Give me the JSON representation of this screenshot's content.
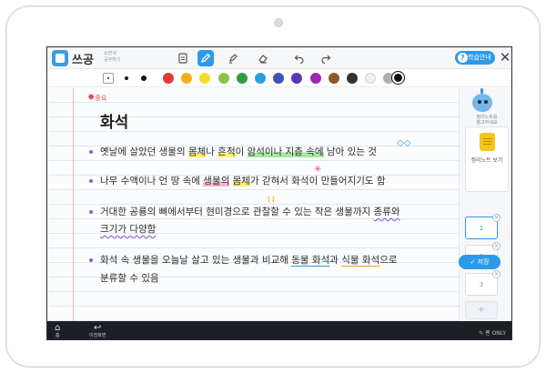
{
  "app": {
    "title": "쓰공",
    "subtitle_line1": "쓰면서",
    "subtitle_line2": "공부하기",
    "help_label": "학습안내",
    "close_glyph": "✕"
  },
  "toolbar": {
    "tools": [
      {
        "name": "page-icon",
        "active": false
      },
      {
        "name": "pen-icon",
        "active": true
      },
      {
        "name": "highlighter-icon",
        "active": false
      },
      {
        "name": "eraser-icon",
        "active": false
      },
      {
        "name": "undo-icon",
        "active": false
      },
      {
        "name": "redo-icon",
        "active": false
      }
    ]
  },
  "palette": {
    "colors": [
      "#e53935",
      "#f2b01e",
      "#f5dc2a",
      "#8bc34a",
      "#2e9e44",
      "#2aa0d8",
      "#3f51b5",
      "#5e35b1",
      "#9c27b0",
      "#8d5a2b",
      "#333333",
      "#f0f0f0",
      "#b0b0b0"
    ]
  },
  "note": {
    "star_tag": "중요",
    "title": "화석",
    "lines": [
      {
        "parts": [
          {
            "text": "옛날에 살았던 생물의 ",
            "style": ""
          },
          {
            "text": "몸체",
            "style": "hl-yellow"
          },
          {
            "text": "나 ",
            "style": ""
          },
          {
            "text": "흔적",
            "style": "hl-yellow"
          },
          {
            "text": "이 ",
            "style": ""
          },
          {
            "text": "암석이나 지층 속에",
            "style": "hl-green"
          },
          {
            "text": " 남아 있는 것",
            "style": ""
          }
        ]
      },
      {
        "parts": [
          {
            "text": "나무 수액이나 언 땅 속에 ",
            "style": ""
          },
          {
            "text": "생물의",
            "style": "hl-pink"
          },
          {
            "text": " ",
            "style": ""
          },
          {
            "text": "몸체",
            "style": "hl-yellow"
          },
          {
            "text": "가 갇혀서 화석이 만들어지기도 함",
            "style": ""
          }
        ]
      },
      {
        "parts": [
          {
            "text": "거대한 공룡의 뼈에서부터 현미경으로 관찰할 수 있는 작은 생물까지 ",
            "style": ""
          },
          {
            "text": "종류와",
            "style": "ul-wave"
          }
        ]
      },
      {
        "parts": [
          {
            "text": "크기가 다양함",
            "style": "ul-wave"
          }
        ]
      },
      {
        "parts": [
          {
            "text": "화석 속 생물을 오늘날 살고 있는 생물과 비교해 ",
            "style": ""
          },
          {
            "text": "동물 화석",
            "style": "ul-blue"
          },
          {
            "text": "과 ",
            "style": ""
          },
          {
            "text": "식물 화석",
            "style": "ul-orange"
          },
          {
            "text": "으로",
            "style": ""
          }
        ]
      },
      {
        "parts": [
          {
            "text": "분류할 수 있음",
            "style": ""
          }
        ]
      }
    ]
  },
  "side": {
    "label_line1": "정리노트를",
    "label_line2": "참고하세요",
    "notebook_label": "정리노트 보기",
    "pages": [
      "1",
      "2",
      "3"
    ],
    "active_page": "1",
    "add_glyph": "+",
    "thumb_close_glyph": "×",
    "save_label": "✓ 저장"
  },
  "navbar": {
    "home_label": "홈",
    "back_label_line1": "이전",
    "back_label_line2": "화면",
    "pen_only": "✎ 펜 ONLY"
  }
}
